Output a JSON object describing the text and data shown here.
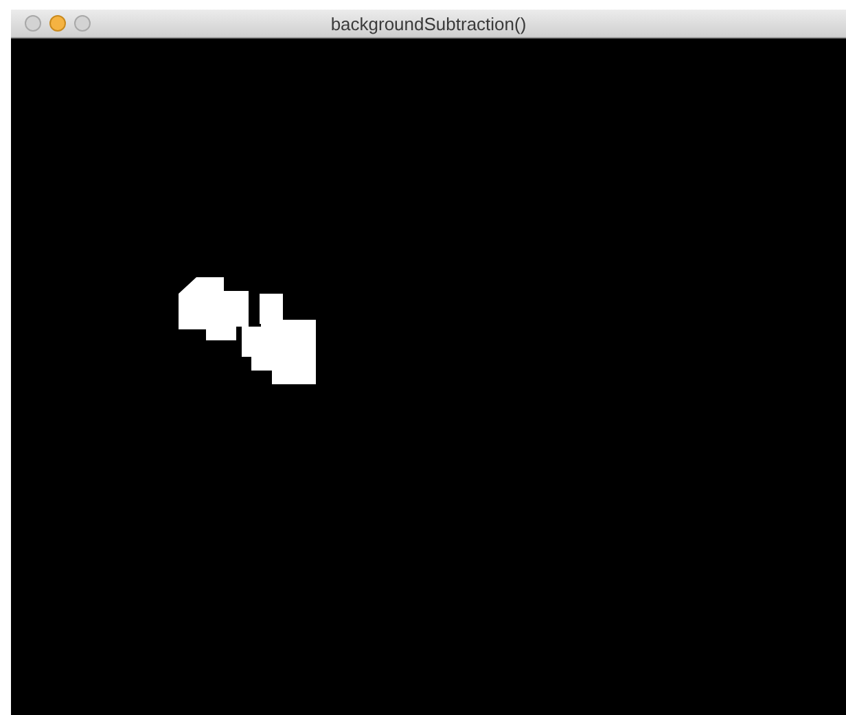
{
  "window": {
    "title": "backgroundSubtraction()"
  }
}
